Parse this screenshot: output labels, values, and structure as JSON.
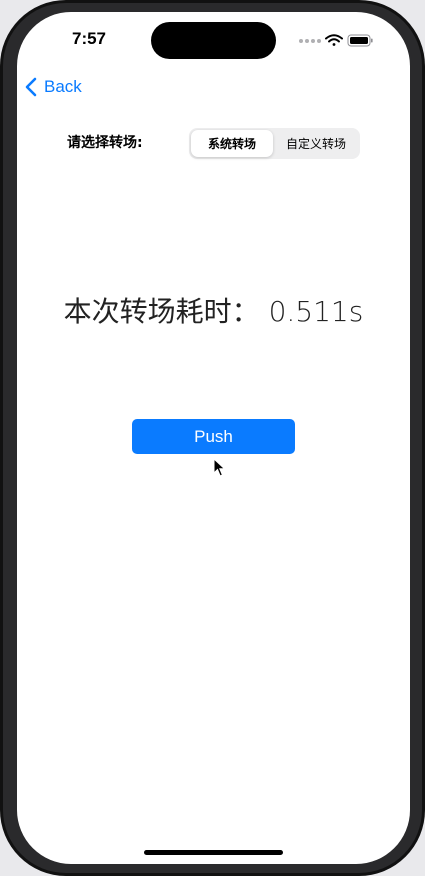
{
  "status_bar": {
    "time": "7:57",
    "icons": [
      "signal-dots-icon",
      "wifi-icon",
      "battery-icon"
    ]
  },
  "nav": {
    "back_label": "Back",
    "back_icon": "chevron-left-icon",
    "accent_color": "#0a7bff"
  },
  "transition_picker": {
    "label": "请选择转场:",
    "options": [
      "系统转场",
      "自定义转场"
    ],
    "selected": "系统转场"
  },
  "result": {
    "duration_text": "本次转场耗时： 0.511s"
  },
  "actions": {
    "push_label": "Push",
    "push_color": "#0a7bff"
  }
}
